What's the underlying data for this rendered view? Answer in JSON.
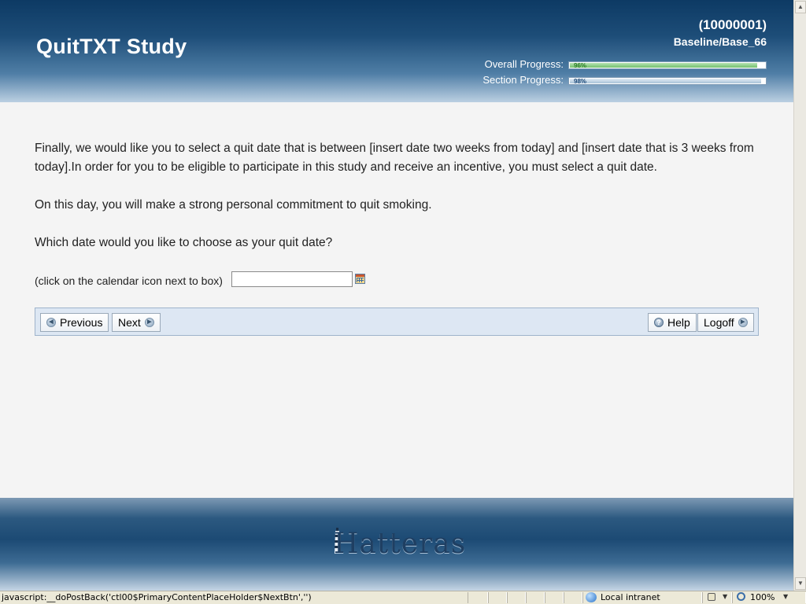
{
  "header": {
    "title": "QuitTXT Study",
    "participant_id": "10000001",
    "section": "Baseline/Base_66",
    "overall_progress": {
      "label": "Overall Progress:",
      "percent_text": "96%",
      "fraction": 0.96
    },
    "section_progress": {
      "label": "Section Progress:",
      "percent_text": "98%",
      "fraction": 0.98
    }
  },
  "content": {
    "paragraph1": "Finally, we would like you to select a quit date that is between [insert date two weeks from today] and [insert date that is 3 weeks from today].In order for you to be eligible to participate in this study and receive an incentive, you must select a quit date.",
    "paragraph2": "On this day, you will make a strong personal commitment to quit smoking.",
    "question": "Which date would you like to choose as your quit date?",
    "calendar_hint": "(click on the calendar icon next to box)",
    "date_value": ""
  },
  "nav": {
    "previous": "Previous",
    "next": "Next",
    "help": "Help",
    "logoff": "Logoff",
    "icons": {
      "previous": "rewind-circle-icon",
      "next": "fast-forward-circle-icon",
      "help": "help-circle-icon",
      "logoff": "fast-forward-circle-icon"
    }
  },
  "footer": {
    "brand": "Hatteras",
    "logo_icon": "lighthouse-icon"
  },
  "statusbar": {
    "text": "javascript:__doPostBack('ctl00$PrimaryContentPlaceHolder$NextBtn','')",
    "zone": "Local intranet",
    "zoom": "100%",
    "icons": [
      "globe-icon",
      "lock-icon",
      "zoom-icon"
    ]
  },
  "colors": {
    "header_dark": "#0d3a64",
    "progress_green": "#74c06e",
    "progress_blue": "#a9c2d8",
    "navbar_bg": "#dde7f3",
    "page_bg": "#f4f4f4"
  }
}
